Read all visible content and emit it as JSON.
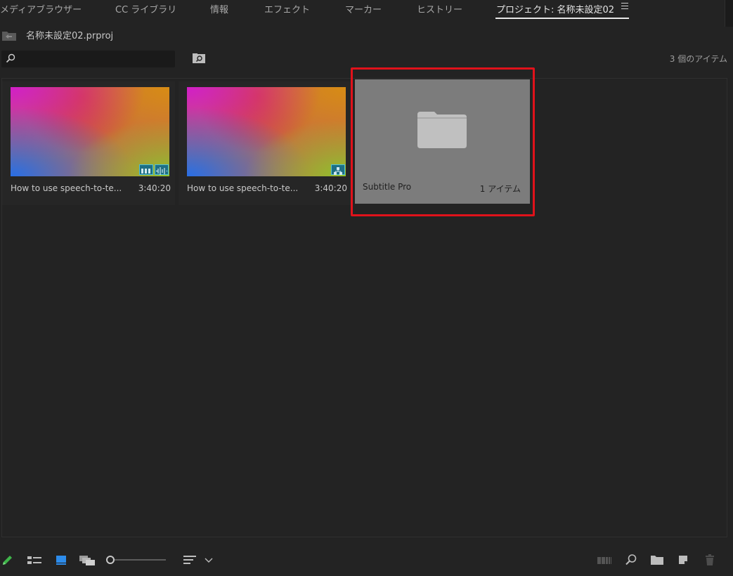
{
  "tabs": [
    {
      "label": "メディアブラウザー"
    },
    {
      "label": "CC ライブラリ"
    },
    {
      "label": "情報"
    },
    {
      "label": "エフェクト"
    },
    {
      "label": "マーカー"
    },
    {
      "label": "ヒストリー"
    },
    {
      "label": "プロジェクト: 名称未設定02",
      "active": true
    }
  ],
  "project": {
    "file_name": "名称未設定02.prproj",
    "item_count": "3 個のアイテム"
  },
  "search": {
    "value": ""
  },
  "items": [
    {
      "type": "sequence",
      "name": "How to use speech-to-te...",
      "duration": "3:40:20"
    },
    {
      "type": "clip",
      "name": "How to use speech-to-te...",
      "duration": "3:40:20"
    },
    {
      "type": "bin",
      "name": "Subtitle Pro",
      "count": "1 アイテム",
      "highlighted": true
    }
  ],
  "colors": {
    "background": "#232323",
    "folder_tile": "#7c7c7c",
    "highlight": "#e0121b",
    "badge": "#1e6f84",
    "pencil_accent": "#3fb54a",
    "icon_view_accent": "#2d8ceb"
  },
  "toolbar": {
    "left": [
      "pencil-icon",
      "list-view-icon",
      "icon-view-icon",
      "freeform-view-icon",
      "zoom-slider",
      "sort-icon"
    ],
    "right": [
      "automate-to-sequence-icon",
      "find-icon",
      "new-bin-icon",
      "new-item-icon",
      "trash-icon"
    ]
  }
}
